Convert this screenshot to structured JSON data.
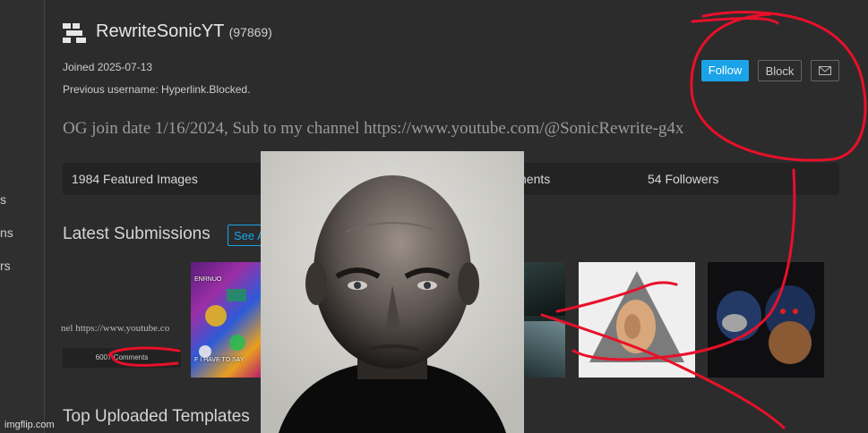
{
  "sidebar": {
    "items": [
      "s",
      "ns",
      "rs"
    ]
  },
  "profile": {
    "username": "RewriteSonicYT",
    "points": "(97869)",
    "joined": "Joined 2025-07-13",
    "previous_username": "Previous username: Hyperlink.Blocked.",
    "bio": "OG join date 1/16/2024, Sub to my channel https://www.youtube.com/@SonicRewrite-g4x"
  },
  "buttons": {
    "follow": "Follow",
    "block": "Block"
  },
  "stats": {
    "featured": "1984 Featured Images",
    "comments": "nents",
    "followers": "54 Followers"
  },
  "sections": {
    "latest": "Latest Submissions",
    "see_all": "See A",
    "top_templates": "Top Uploaded Templates"
  },
  "submissions": {
    "first_text": "nel https://www.youtube.co",
    "first_comments": "6007 Comments",
    "second_caption_top": "ENRNUO",
    "second_caption_bottom": "F I HAVE TO SAY"
  },
  "watermark": "imgflip.com",
  "colors": {
    "accent": "#1aa3e8",
    "annotation": "#e8102a",
    "background": "#2c2c2c"
  }
}
